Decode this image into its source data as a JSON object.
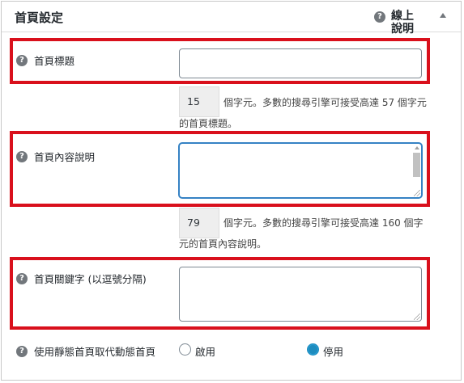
{
  "panel": {
    "title": "首頁設定",
    "help_label": "線上說明"
  },
  "fields": {
    "home_title": {
      "label": "首頁標題",
      "value": "",
      "count": "15",
      "counter_text": "個字元。多數的搜尋引擎可接受高達 57 個字元的首頁標題。"
    },
    "home_description": {
      "label": "首頁內容說明",
      "value": "",
      "count": "79",
      "counter_text": "個字元。多數的搜尋引擎可接受高達 160 個字元的首頁內容說明。"
    },
    "home_keywords": {
      "label": "首頁關鍵字 (以逗號分隔)",
      "value": ""
    },
    "static_front_page": {
      "label": "使用靜態首頁取代動態首頁",
      "options": [
        {
          "label": "啟用",
          "checked": false
        },
        {
          "label": "停用",
          "checked": true
        }
      ]
    }
  },
  "colors": {
    "highlight": "#d9101c",
    "radio_checked": "#1e8cbe"
  }
}
